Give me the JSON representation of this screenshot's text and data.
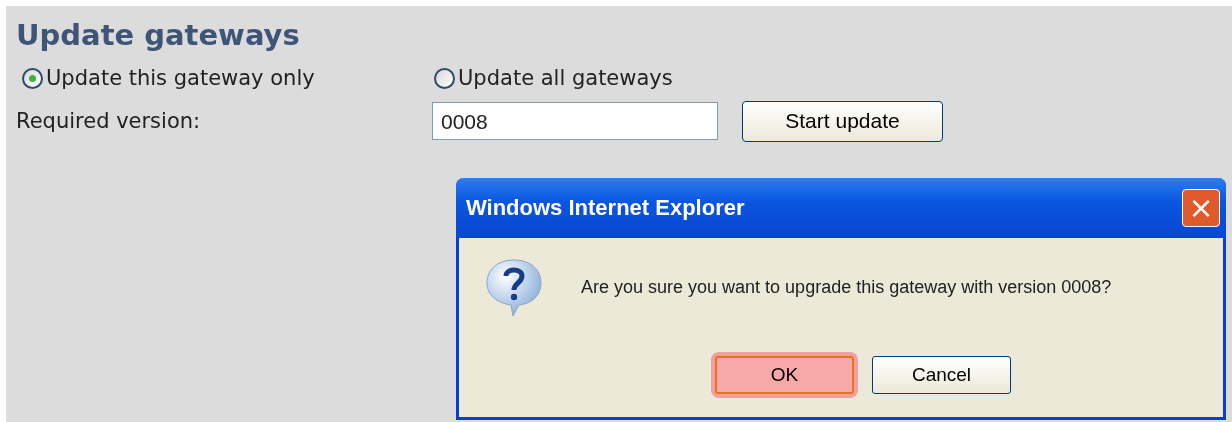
{
  "heading": "Update gateways",
  "radios": [
    {
      "label": "Update this gateway only",
      "selected": true
    },
    {
      "label": "Update all gateways",
      "selected": false
    }
  ],
  "version": {
    "label": "Required version:",
    "value": "0008"
  },
  "start_button": "Start update",
  "dialog": {
    "title": "Windows Internet Explorer",
    "close": "×",
    "message": "Are you sure you want to upgrade this gateway with version 0008?",
    "buttons": [
      {
        "label": "OK",
        "focused": true
      },
      {
        "label": "Cancel",
        "focused": false
      }
    ]
  }
}
